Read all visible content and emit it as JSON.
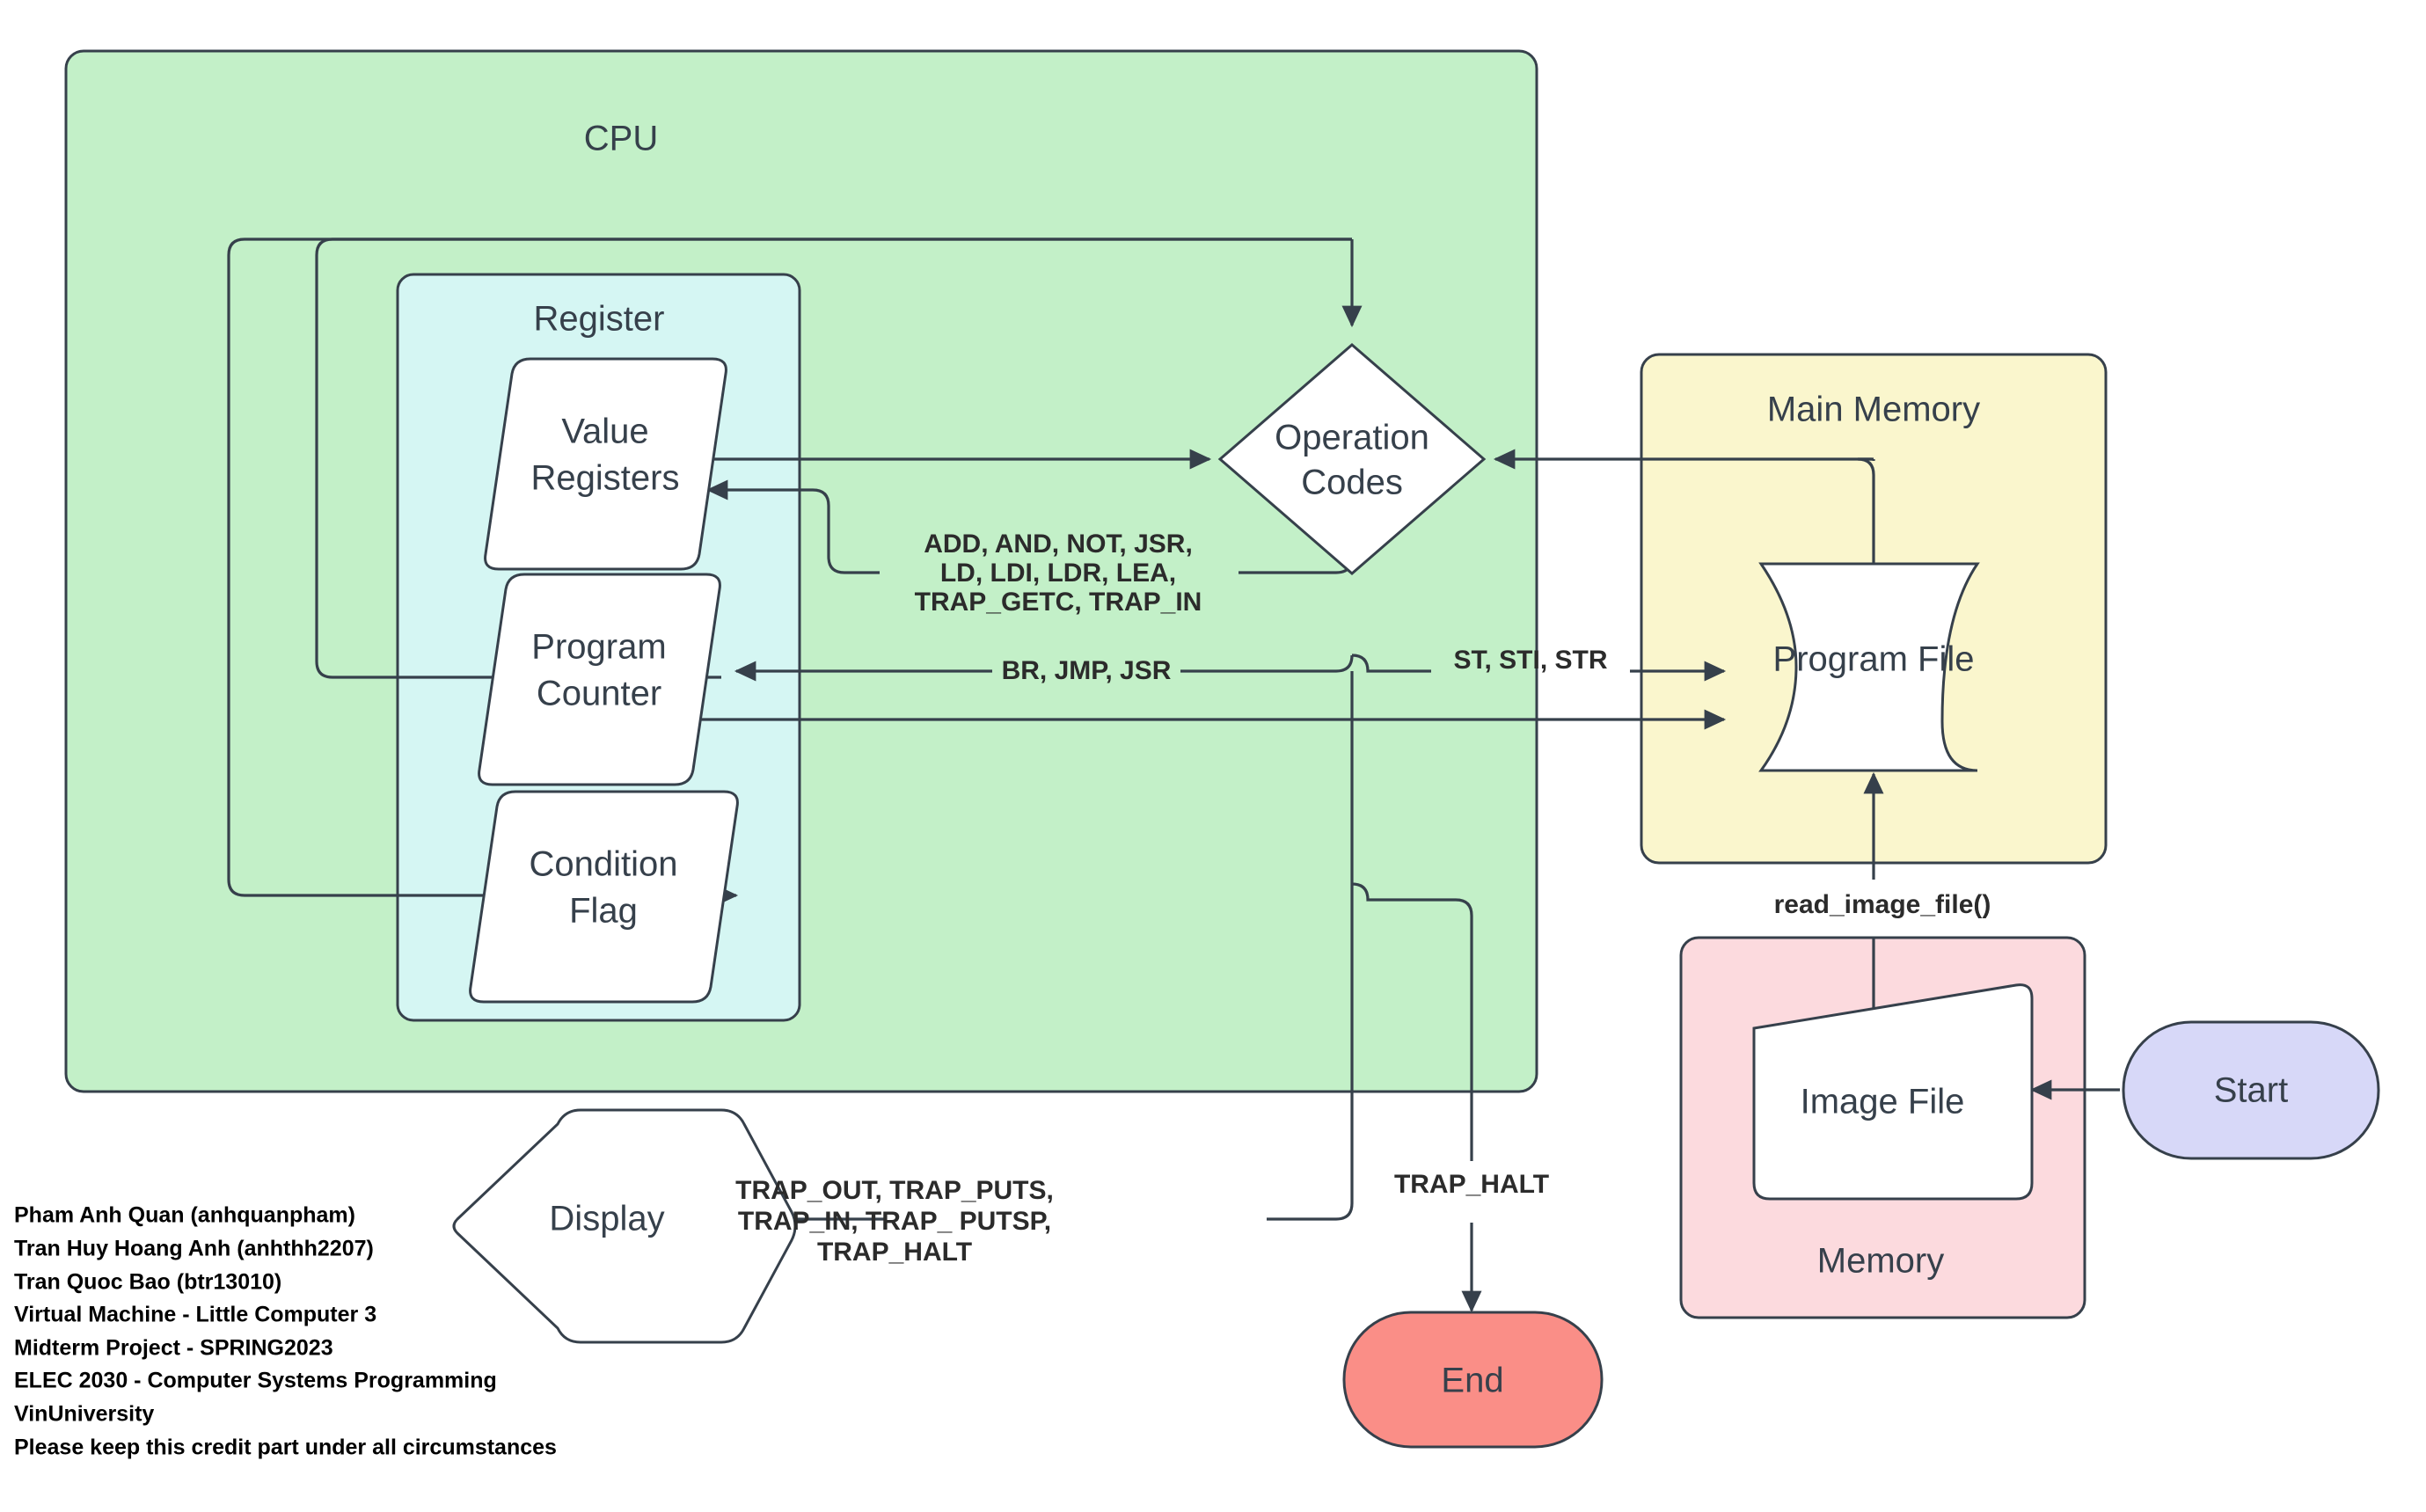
{
  "diagram": {
    "title": "LC-3 Virtual Machine Architecture Flow Diagram",
    "containers": {
      "cpu": {
        "label": "CPU",
        "fill": "#c3f0c8",
        "stroke": "#36404b"
      },
      "register": {
        "label": "Register",
        "fill": "#d5f6f3",
        "stroke": "#36404b"
      },
      "main_memory": {
        "label": "Main Memory",
        "fill": "#faf6cd",
        "stroke": "#36404b"
      },
      "memory": {
        "label": "Memory",
        "fill": "#fcdade",
        "stroke": "#36404b"
      }
    },
    "nodes": {
      "value_registers": {
        "label_line1": "Value",
        "label_line2": "Registers",
        "shape": "parallelogram",
        "fill": "#ffffff"
      },
      "program_counter": {
        "label_line1": "Program",
        "label_line2": "Counter",
        "shape": "parallelogram",
        "fill": "#ffffff"
      },
      "condition_flag": {
        "label_line1": "Condition",
        "label_line2": "Flag",
        "shape": "parallelogram",
        "fill": "#ffffff"
      },
      "operation_codes": {
        "label_line1": "Operation",
        "label_line2": "Codes",
        "shape": "diamond",
        "fill": "#ffffff"
      },
      "program_file": {
        "label": "Program File",
        "shape": "cylinder-horizontal",
        "fill": "#ffffff"
      },
      "image_file": {
        "label": "Image File",
        "shape": "trapezoid",
        "fill": "#ffffff"
      },
      "display": {
        "label": "Display",
        "shape": "hexagon",
        "fill": "#ffffff"
      },
      "start": {
        "label": "Start",
        "shape": "terminator",
        "fill": "#d7d8f8"
      },
      "end": {
        "label": "End",
        "shape": "terminator",
        "fill": "#fa8e87"
      }
    },
    "edge_labels": {
      "alu_ops_l1": "ADD, AND, NOT, JSR,",
      "alu_ops_l2": "LD, LDI, LDR, LEA,",
      "alu_ops_l3": "TRAP_GETC, TRAP_IN",
      "branch_ops": "BR, JMP, JSR",
      "store_ops": "ST, STI, STR",
      "trap_out_l1": "TRAP_OUT, TRAP_PUTS,",
      "trap_out_l2": "TRAP_IN, TRAP_ PUTSP,",
      "trap_out_l3": "TRAP_HALT",
      "trap_halt": "TRAP_HALT",
      "read_image_file": "read_image_file()"
    },
    "credits": [
      "Pham Anh Quan (anhquanpham)",
      "Tran Huy Hoang Anh (anhthh2207)",
      "Tran Quoc Bao (btr13010)",
      "Virtual Machine - Little Computer 3",
      "Midterm Project - SPRING2023",
      "ELEC 2030 - Computer Systems Programming",
      "VinUniversity",
      "Please keep this credit part under all circumstances"
    ]
  }
}
